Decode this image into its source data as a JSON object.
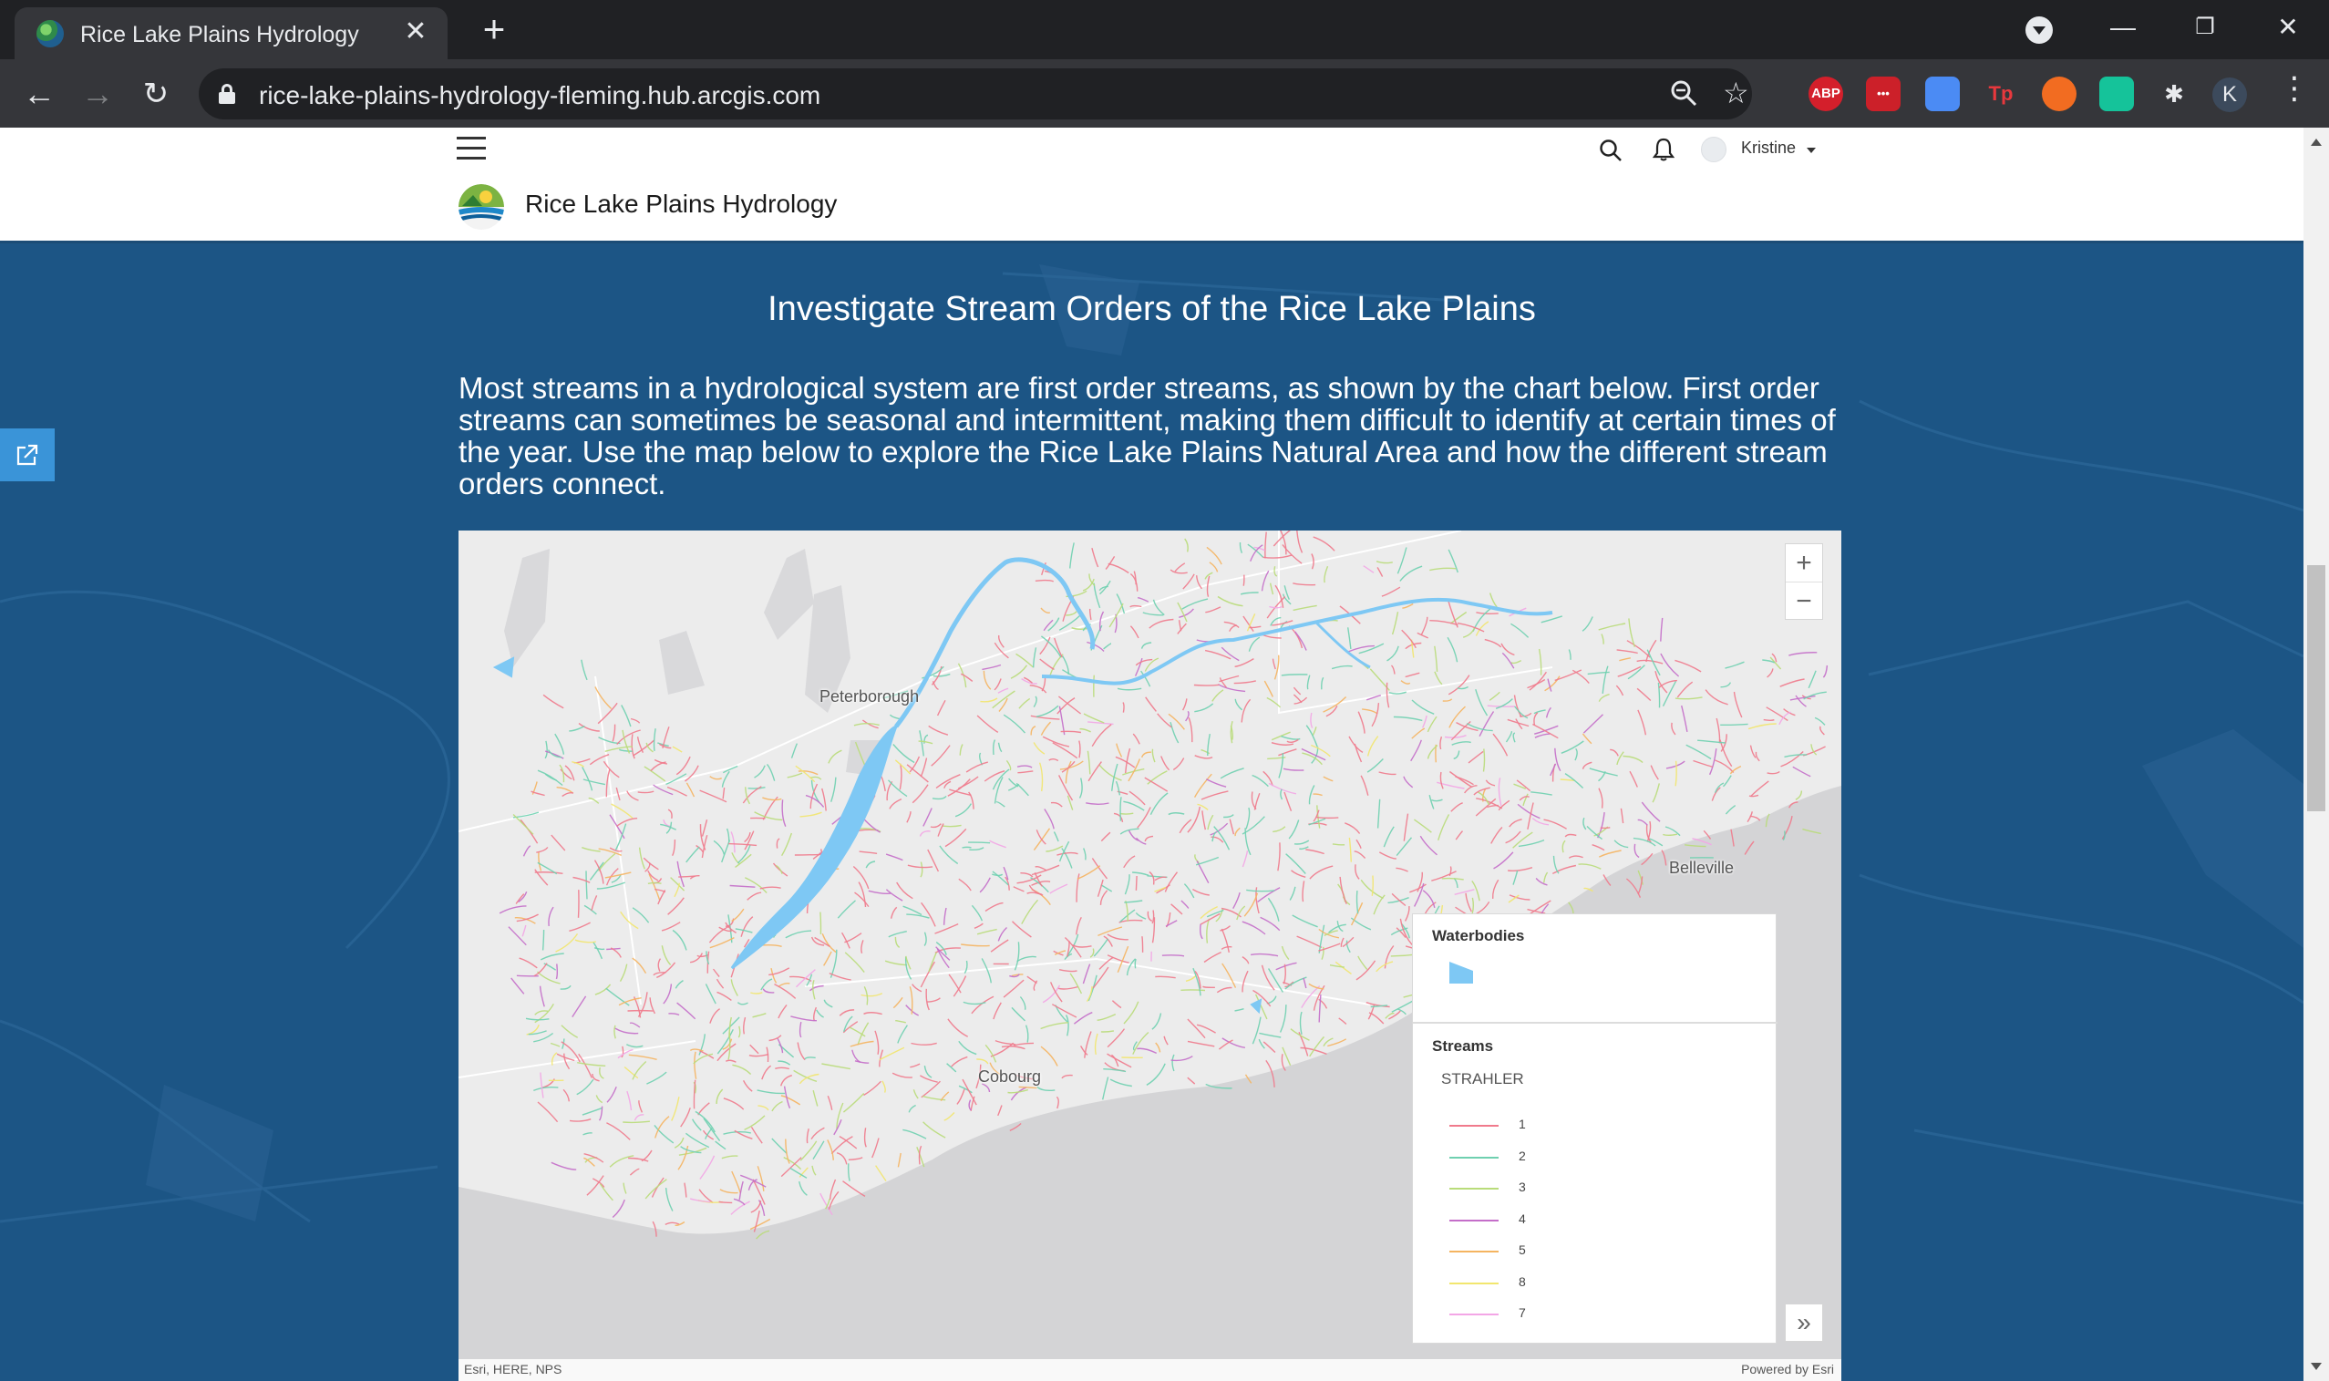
{
  "browser": {
    "tab_title": "Rice Lake Plains Hydrology",
    "url": "rice-lake-plains-hydrology-fleming.hub.arcgis.com",
    "profile_initial": "K",
    "extensions": [
      {
        "name": "adblock-plus-icon",
        "label": "ABP",
        "color": "#d41f2b"
      },
      {
        "name": "lastpass-icon",
        "label": "•••",
        "color": "#cc2029"
      },
      {
        "name": "docs-icon",
        "label": "",
        "color": "#4b8bf4"
      },
      {
        "name": "tp-extension-icon",
        "label": "Tp",
        "color": "#e8383d"
      },
      {
        "name": "honey-extension-icon",
        "label": "",
        "color": "#f26c21"
      },
      {
        "name": "grammar-extension-icon",
        "label": "",
        "color": "#15c39a"
      }
    ]
  },
  "site": {
    "title": "Rice Lake Plains Hydrology",
    "user_name": "Kristine"
  },
  "section": {
    "heading": "Investigate Stream Orders of the Rice Lake Plains",
    "body": "Most streams in a hydrological system are first order streams, as shown by the chart below. First order streams can sometimes be seasonal and intermittent, making them difficult to identify at certain times of the year. Use the map below to explore the Rice Lake Plains Natural Area and how the different stream orders connect."
  },
  "map": {
    "labels": {
      "peterborough": "Peterborough",
      "belleville": "Belleville",
      "cobourg": "Cobourg"
    },
    "zoom_in": "+",
    "zoom_out": "−",
    "legend": {
      "waterbodies_title": "Waterbodies",
      "waterbody_color": "#7ec8f4",
      "streams_title": "Streams",
      "field": "STRAHLER",
      "classes": [
        {
          "label": "1",
          "color": "#f07a8c"
        },
        {
          "label": "2",
          "color": "#6fd0b0"
        },
        {
          "label": "3",
          "color": "#b9dc7a"
        },
        {
          "label": "4",
          "color": "#c46ec9"
        },
        {
          "label": "5",
          "color": "#f5b460"
        },
        {
          "label": "8",
          "color": "#f2e66e"
        },
        {
          "label": "7",
          "color": "#f3a6e6"
        }
      ]
    },
    "attribution_left": "Esri, HERE, NPS",
    "attribution_right": "Powered by Esri"
  }
}
